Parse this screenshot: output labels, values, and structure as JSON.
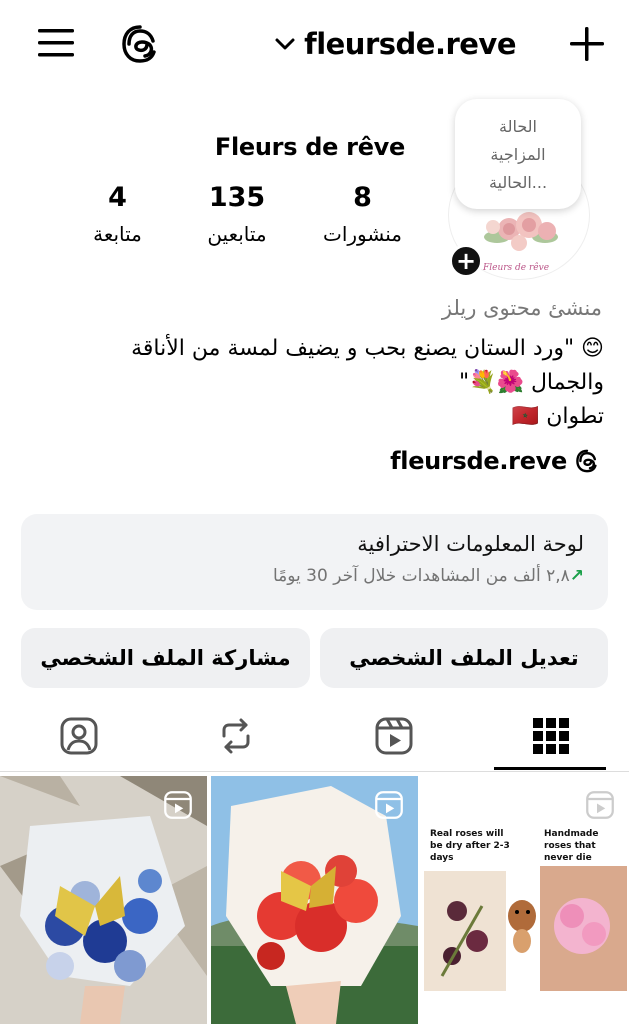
{
  "header": {
    "username": "fleursde.reve"
  },
  "profile": {
    "display_name": "Fleurs de rêve",
    "avatar_brand": "Fleurs de rêve",
    "note_lines": [
      "الحالة",
      "المزاجية",
      "الحالية..."
    ],
    "stats": {
      "posts": {
        "value": "8",
        "label": "منشورات"
      },
      "followers": {
        "value": "135",
        "label": "متابعين"
      },
      "following": {
        "value": "4",
        "label": "متابعة"
      }
    },
    "category": "منشئ محتوى ريلز",
    "bio_lines": [
      "😊 \"ورد الستان يصنع بحب و يضيف لمسة من الأناقة",
      "والجمال 🌺💐\"",
      "تطوان 🇲🇦"
    ],
    "threads_link": "fleursde.reve"
  },
  "dashboard": {
    "title": "لوحة المعلومات الاحترافية",
    "arrow": "↗",
    "subtitle": "٢,٨ ألف من المشاهدات خلال آخر 30 يومًا"
  },
  "buttons": {
    "edit": "تعديل الملف الشخصي",
    "share": "مشاركة الملف الشخصي"
  },
  "tabs": [
    "grid-icon",
    "reels-icon",
    "reposts-icon",
    "tagged-icon"
  ],
  "grid": {
    "post3_left_text": "Real roses will be dry after 2-3 days",
    "post3_right_text": "Handmade roses that never die"
  }
}
